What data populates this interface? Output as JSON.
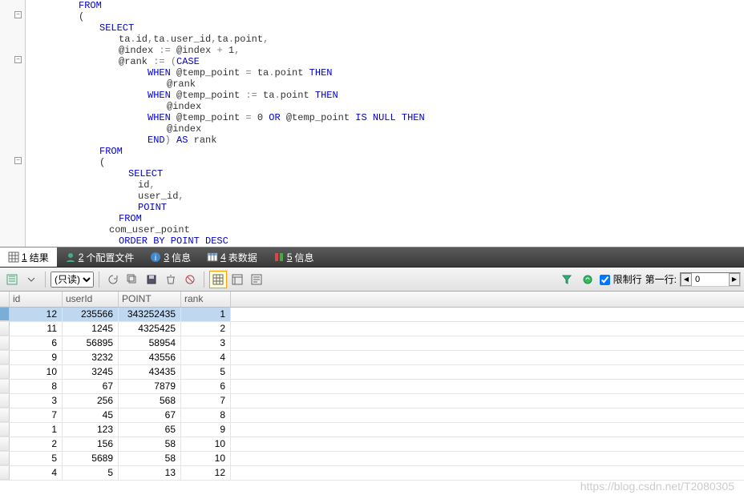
{
  "code": {
    "lines": [
      {
        "indent": 60,
        "tokens": [
          {
            "t": "FROM",
            "c": "kw-blue"
          }
        ]
      },
      {
        "indent": 60,
        "tokens": [
          {
            "t": "(",
            "c": "kw-dark"
          }
        ]
      },
      {
        "indent": 86,
        "tokens": [
          {
            "t": "SELECT",
            "c": "kw-blue"
          }
        ]
      },
      {
        "indent": 110,
        "tokens": [
          {
            "t": "ta",
            "c": "kw-dark"
          },
          {
            "t": ".",
            "c": "kw-gray"
          },
          {
            "t": "id",
            "c": "kw-dark"
          },
          {
            "t": ",",
            "c": "kw-gray"
          },
          {
            "t": "ta",
            "c": "kw-dark"
          },
          {
            "t": ".",
            "c": "kw-gray"
          },
          {
            "t": "user_id",
            "c": "kw-dark"
          },
          {
            "t": ",",
            "c": "kw-gray"
          },
          {
            "t": "ta",
            "c": "kw-dark"
          },
          {
            "t": ".",
            "c": "kw-gray"
          },
          {
            "t": "point",
            "c": "kw-dark"
          },
          {
            "t": ",",
            "c": "kw-gray"
          }
        ]
      },
      {
        "indent": 110,
        "tokens": [
          {
            "t": "@index",
            "c": "kw-dark"
          },
          {
            "t": " := ",
            "c": "kw-gray"
          },
          {
            "t": "@index",
            "c": "kw-dark"
          },
          {
            "t": " + ",
            "c": "kw-gray"
          },
          {
            "t": "1",
            "c": "kw-dark"
          },
          {
            "t": ",",
            "c": "kw-gray"
          }
        ]
      },
      {
        "indent": 110,
        "tokens": [
          {
            "t": "@rank",
            "c": "kw-dark"
          },
          {
            "t": " := (",
            "c": "kw-gray"
          },
          {
            "t": "CASE",
            "c": "kw-blue"
          }
        ]
      },
      {
        "indent": 146,
        "tokens": [
          {
            "t": "WHEN",
            "c": "kw-blue"
          },
          {
            "t": " @temp_point",
            "c": "kw-dark"
          },
          {
            "t": " = ",
            "c": "kw-gray"
          },
          {
            "t": "ta",
            "c": "kw-dark"
          },
          {
            "t": ".",
            "c": "kw-gray"
          },
          {
            "t": "point ",
            "c": "kw-dark"
          },
          {
            "t": "THEN",
            "c": "kw-blue"
          }
        ]
      },
      {
        "indent": 170,
        "tokens": [
          {
            "t": "@rank",
            "c": "kw-dark"
          }
        ]
      },
      {
        "indent": 146,
        "tokens": [
          {
            "t": "WHEN",
            "c": "kw-blue"
          },
          {
            "t": " @temp_point",
            "c": "kw-dark"
          },
          {
            "t": " := ",
            "c": "kw-gray"
          },
          {
            "t": "ta",
            "c": "kw-dark"
          },
          {
            "t": ".",
            "c": "kw-gray"
          },
          {
            "t": "point ",
            "c": "kw-dark"
          },
          {
            "t": "THEN",
            "c": "kw-blue"
          }
        ]
      },
      {
        "indent": 170,
        "tokens": [
          {
            "t": "@index",
            "c": "kw-dark"
          }
        ]
      },
      {
        "indent": 146,
        "tokens": [
          {
            "t": "WHEN",
            "c": "kw-blue"
          },
          {
            "t": " @temp_point",
            "c": "kw-dark"
          },
          {
            "t": " = ",
            "c": "kw-gray"
          },
          {
            "t": "0",
            "c": "kw-dark"
          },
          {
            "t": " OR ",
            "c": "kw-blue"
          },
          {
            "t": "@temp_point ",
            "c": "kw-dark"
          },
          {
            "t": "IS NULL THEN",
            "c": "kw-blue"
          }
        ]
      },
      {
        "indent": 170,
        "tokens": [
          {
            "t": "@index",
            "c": "kw-dark"
          }
        ]
      },
      {
        "indent": 146,
        "tokens": [
          {
            "t": "END",
            "c": "kw-blue"
          },
          {
            "t": ") ",
            "c": "kw-gray"
          },
          {
            "t": "AS",
            "c": "kw-blue"
          },
          {
            "t": " rank",
            "c": "kw-dark"
          }
        ]
      },
      {
        "indent": 86,
        "tokens": [
          {
            "t": "FROM",
            "c": "kw-blue"
          }
        ]
      },
      {
        "indent": 86,
        "tokens": [
          {
            "t": "(",
            "c": "kw-dark"
          }
        ]
      },
      {
        "indent": 122,
        "tokens": [
          {
            "t": "SELECT",
            "c": "kw-blue"
          }
        ]
      },
      {
        "indent": 134,
        "tokens": [
          {
            "t": "id",
            "c": "kw-dark"
          },
          {
            "t": ",",
            "c": "kw-gray"
          }
        ]
      },
      {
        "indent": 134,
        "tokens": [
          {
            "t": "user_id",
            "c": "kw-dark"
          },
          {
            "t": ",",
            "c": "kw-gray"
          }
        ]
      },
      {
        "indent": 134,
        "tokens": [
          {
            "t": "POINT",
            "c": "kw-blue"
          }
        ]
      },
      {
        "indent": 110,
        "tokens": [
          {
            "t": "FROM",
            "c": "kw-blue"
          }
        ]
      },
      {
        "indent": 98,
        "tokens": [
          {
            "t": "com_user_point",
            "c": "kw-dark"
          }
        ]
      },
      {
        "indent": 110,
        "tokens": [
          {
            "t": "ORDER BY POINT DESC",
            "c": "kw-blue"
          }
        ]
      }
    ],
    "folds": [
      14,
      70,
      196
    ]
  },
  "tabs": [
    {
      "num": "1",
      "label": "结果",
      "active": true,
      "icon": "grid"
    },
    {
      "num": "2",
      "label": "个配置文件",
      "active": false,
      "icon": "profile"
    },
    {
      "num": "3",
      "label": "信息",
      "active": false,
      "icon": "info"
    },
    {
      "num": "4",
      "label": "表数据",
      "active": false,
      "icon": "table"
    },
    {
      "num": "5",
      "label": "信息",
      "active": false,
      "icon": "info2"
    }
  ],
  "toolbar": {
    "readonly_label": "(只读)",
    "limit_label": "限制行",
    "firstrow_label": "第一行:",
    "firstrow_value": "0"
  },
  "grid": {
    "columns": [
      "id",
      "userId",
      "POINT",
      "rank"
    ],
    "rows": [
      {
        "id": 12,
        "userId": 235566,
        "POINT": 343252435,
        "rank": 1,
        "selected": true
      },
      {
        "id": 11,
        "userId": 1245,
        "POINT": 4325425,
        "rank": 2
      },
      {
        "id": 6,
        "userId": 56895,
        "POINT": 58954,
        "rank": 3
      },
      {
        "id": 9,
        "userId": 3232,
        "POINT": 43556,
        "rank": 4
      },
      {
        "id": 10,
        "userId": 3245,
        "POINT": 43435,
        "rank": 5
      },
      {
        "id": 8,
        "userId": 67,
        "POINT": 7879,
        "rank": 6
      },
      {
        "id": 3,
        "userId": 256,
        "POINT": 568,
        "rank": 7
      },
      {
        "id": 7,
        "userId": 45,
        "POINT": 67,
        "rank": 8
      },
      {
        "id": 1,
        "userId": 123,
        "POINT": 65,
        "rank": 9
      },
      {
        "id": 2,
        "userId": 156,
        "POINT": 58,
        "rank": 10
      },
      {
        "id": 5,
        "userId": 5689,
        "POINT": 58,
        "rank": 10
      },
      {
        "id": 4,
        "userId": 5,
        "POINT": 13,
        "rank": 12
      }
    ]
  },
  "watermark": "https://blog.csdn.net/T2080305"
}
